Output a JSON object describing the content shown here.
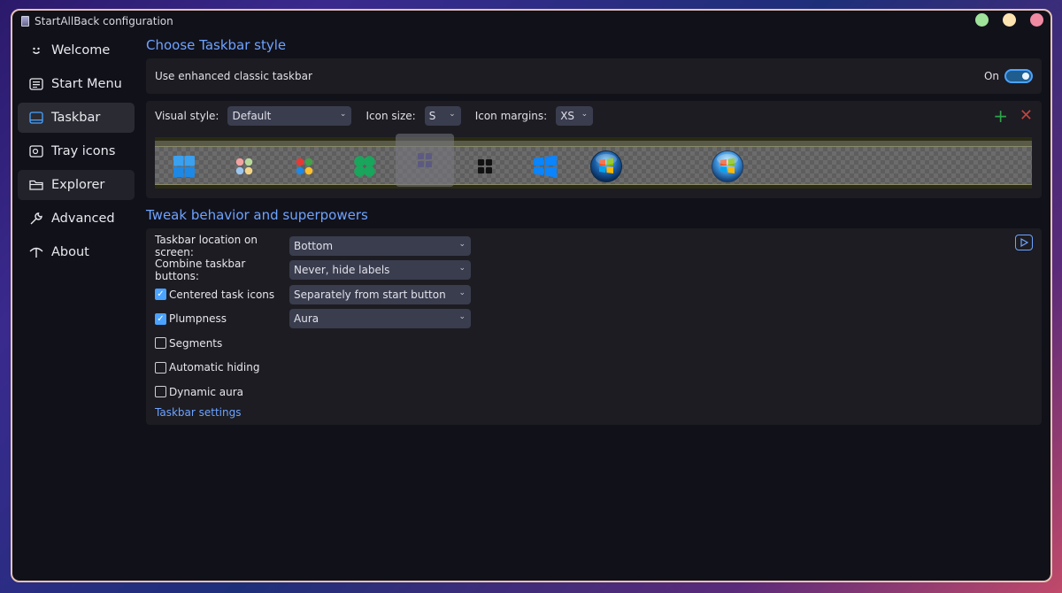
{
  "window": {
    "title": "StartAllBack configuration"
  },
  "sidebar": {
    "items": [
      {
        "label": "Welcome",
        "icon": "smiley-icon"
      },
      {
        "label": "Start Menu",
        "icon": "start-menu-icon"
      },
      {
        "label": "Taskbar",
        "icon": "taskbar-icon"
      },
      {
        "label": "Tray icons",
        "icon": "tray-icon"
      },
      {
        "label": "Explorer",
        "icon": "folder-icon"
      },
      {
        "label": "Advanced",
        "icon": "wrench-icon"
      },
      {
        "label": "About",
        "icon": "about-icon"
      }
    ],
    "active_index": 2
  },
  "taskbar_style": {
    "title": "Choose Taskbar style",
    "enhanced_label": "Use enhanced classic taskbar",
    "enhanced_state": "On",
    "visual_style_label": "Visual style:",
    "visual_style_value": "Default",
    "icon_size_label": "Icon size:",
    "icon_size_value": "S",
    "icon_margins_label": "Icon margins:",
    "icon_margins_value": "XS",
    "start_buttons": [
      "win11-blue",
      "dots-pastel",
      "dots-colored",
      "clover-green",
      "squares-purple",
      "squares-black",
      "win10-blue",
      "win7-orb-1",
      "win7-orb-2"
    ],
    "selected_start_button": 4
  },
  "behavior": {
    "title": "Tweak behavior and superpowers",
    "location_label": "Taskbar location on screen:",
    "location_value": "Bottom",
    "combine_label": "Combine taskbar buttons:",
    "combine_value": "Never, hide labels",
    "centered_label": "Centered task icons",
    "centered_value": "Separately from start button",
    "plumpness_label": "Plumpness",
    "plumpness_value": "Aura",
    "segments_label": "Segments",
    "autohide_label": "Automatic hiding",
    "dynamic_aura_label": "Dynamic aura",
    "settings_link": "Taskbar settings"
  },
  "colors": {
    "accent": "#4aa3ff",
    "link": "#6ea3ff",
    "add": "#2fa34a",
    "delete": "#c0443f"
  }
}
